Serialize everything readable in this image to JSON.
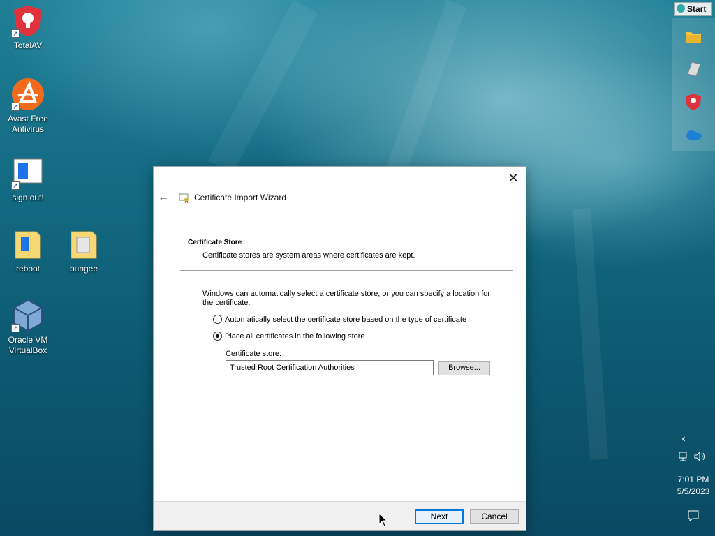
{
  "desktop": {
    "icons": [
      {
        "label": "TotalAV"
      },
      {
        "label": "Avast Free\nAntivirus"
      },
      {
        "label": "sign out!"
      },
      {
        "label": "reboot"
      },
      {
        "label": "bungee"
      },
      {
        "label": "Oracle VM\nVirtualBox"
      }
    ]
  },
  "taskbar": {
    "start_label": "Start",
    "pinned_icons": [
      "folder-icon",
      "notepad-icon",
      "totalav-icon",
      "onedrive-icon"
    ],
    "tray_chevron": "chevron-left-icon",
    "clock_time": "7:01 PM",
    "clock_date": "5/5/2023"
  },
  "dialog": {
    "title": "Certificate Import Wizard",
    "section_title": "Certificate Store",
    "section_desc": "Certificate stores are system areas where certificates are kept.",
    "paragraph": "Windows can automatically select a certificate store, or you can specify a location for the certificate.",
    "option_auto": "Automatically select the certificate store based on the type of certificate",
    "option_place": "Place all certificates in the following store",
    "selected_option": "option_place",
    "store_label": "Certificate store:",
    "store_value": "Trusted Root Certification Authorities",
    "browse_label": "Browse...",
    "next_label": "Next",
    "cancel_label": "Cancel"
  },
  "colors": {
    "accent": "#0078d7",
    "desktop_bg": "#136b82"
  }
}
